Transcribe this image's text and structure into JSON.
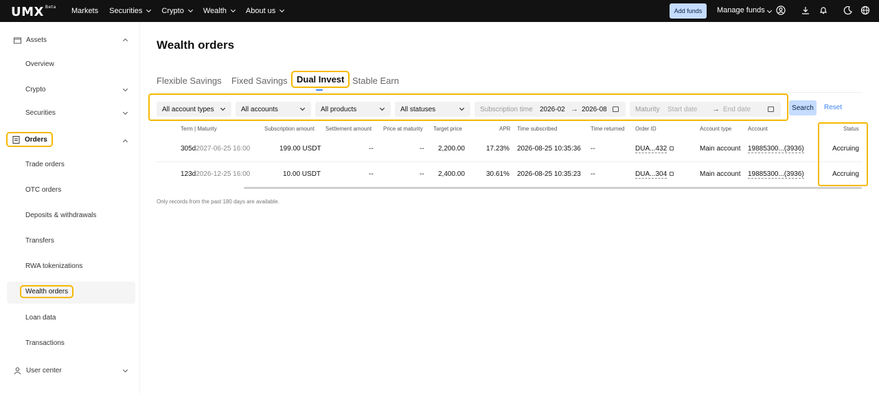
{
  "topbar": {
    "logo": "UMX",
    "logo_badge": "Beta",
    "nav": [
      {
        "label": "Markets",
        "dropdown": false
      },
      {
        "label": "Securities",
        "dropdown": true
      },
      {
        "label": "Crypto",
        "dropdown": true
      },
      {
        "label": "Wealth",
        "dropdown": true
      },
      {
        "label": "About us",
        "dropdown": true
      }
    ],
    "add_funds": "Add funds",
    "manage_funds": "Manage funds",
    "icons": [
      "user-icon",
      "download-icon",
      "bell-icon",
      "moon-icon",
      "globe-icon"
    ]
  },
  "sidebar": {
    "assets": "Assets",
    "overview": "Overview",
    "crypto": "Crypto",
    "securities": "Securities",
    "orders": "Orders",
    "trade_orders": "Trade orders",
    "otc_orders": "OTC orders",
    "deposits_withdrawals": "Deposits & withdrawals",
    "transfers": "Transfers",
    "rwa_tokenizations": "RWA tokenizations",
    "wealth_orders": "Wealth orders",
    "loan_data": "Loan data",
    "transactions": "Transactions",
    "user_center": "User center"
  },
  "main": {
    "title": "Wealth orders",
    "tabs": {
      "flexible": "Flexible Savings",
      "fixed": "Fixed Savings",
      "dual": "Dual Invest",
      "stable": "Stable Earn"
    },
    "filters": {
      "account_types": "All account types",
      "accounts": "All accounts",
      "products": "All products",
      "statuses": "All statuses",
      "subscription_label": "Subscription time",
      "subscription_start": "2026-02",
      "subscription_end": "2026-08",
      "maturity_label": "Maturity",
      "maturity_start_placeholder": "Start date",
      "maturity_end_placeholder": "End date",
      "arrow": "→"
    },
    "search": "Search",
    "reset": "Reset",
    "columns": {
      "term": "Term",
      "maturity": "Maturity",
      "subscription_amount": "Subscription amount",
      "settlement_amount": "Settlement amount",
      "price_at_maturity": "Price at maturity",
      "target_price": "Target price",
      "apr": "APR",
      "time_subscribed": "Time subscribed",
      "time_returned": "Time returned",
      "order_id": "Order ID",
      "account_type": "Account type",
      "account": "Account",
      "status": "Status"
    },
    "rows": [
      {
        "term": "305d",
        "maturity": "2027-06-25 16:00",
        "subscription_amount": "199.00 USDT",
        "settlement_amount": "--",
        "price_at_maturity": "--",
        "target_price": "2,200.00",
        "apr": "17.23%",
        "time_subscribed": "2026-08-25 10:35:36",
        "time_returned": "--",
        "order_id": "DUA...432",
        "account_type": "Main account",
        "account": "19885300...(3936)",
        "status": "Accruing"
      },
      {
        "term": "123d",
        "maturity": "2026-12-25 16:00",
        "subscription_amount": "10.00 USDT",
        "settlement_amount": "--",
        "price_at_maturity": "--",
        "target_price": "2,400.00",
        "apr": "30.61%",
        "time_subscribed": "2026-08-25 10:35:23",
        "time_returned": "--",
        "order_id": "DUA...304",
        "account_type": "Main account",
        "account": "19885300...(3936)",
        "status": "Accruing"
      }
    ],
    "note": "Only records from the past 180 days are available."
  }
}
